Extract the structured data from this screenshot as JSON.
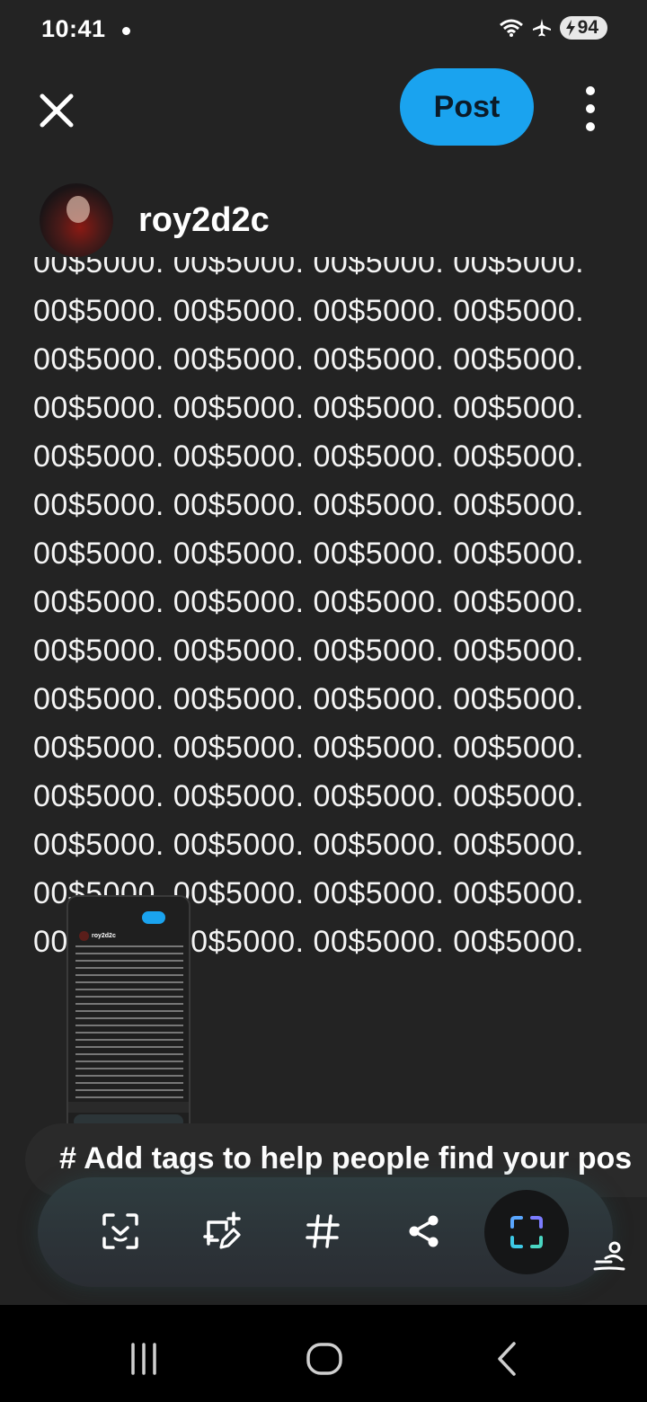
{
  "status_bar": {
    "time": "10:41",
    "battery": "94",
    "icons": [
      "wifi-icon",
      "airplane-icon",
      "battery-charging-icon"
    ]
  },
  "top_bar": {
    "post_label": "Post",
    "close_icon": "close-icon",
    "more_icon": "more-vertical-icon"
  },
  "author": {
    "username": "roy2d2c"
  },
  "post_body": {
    "text": "00$5000. 00$5000. 00$5000. 00$5000. 00$5000. 00$5000. 00$5000. 00$5000. 00$5000. 00$5000. 00$5000. 00$5000. 00$5000. 00$5000. 00$5000. 00$5000. 00$5000. 00$5000. 00$5000. 00$5000. 00$5000. 00$5000. 00$5000. 00$5000. 00$5000. 00$5000. 00$5000. 00$5000. 00$5000. 00$5000. 00$5000. 00$5000. 00$5000. 00$5000. 00$5000. 00$5000. 00$5000. 00$5000. 00$5000. 00$5000. 00$5000. 00$5000. 00$5000. 00$5000. 00$5000. 00$5000. 00$5000. 00$5000. 00$5000. 00$5000. 00$5000. 00$5000. 00$5000. 00$5000. 00$5000. 00$5000. 00$5000. 00$5000. 00$5000. 00$5000."
  },
  "tags": {
    "placeholder": "# Add tags to help people find your pos"
  },
  "toolbar": {
    "tools": [
      "smart-select-icon",
      "edit-crop-icon",
      "hashtag-icon",
      "share-icon",
      "screenshot-capture-icon"
    ]
  },
  "screenshot_preview": {
    "username": "roy2d2c",
    "post_label": "Post"
  },
  "colors": {
    "background": "#232323",
    "accent": "#1aa3ef",
    "toolbar": "#2c3538",
    "navbar": "#000000"
  }
}
